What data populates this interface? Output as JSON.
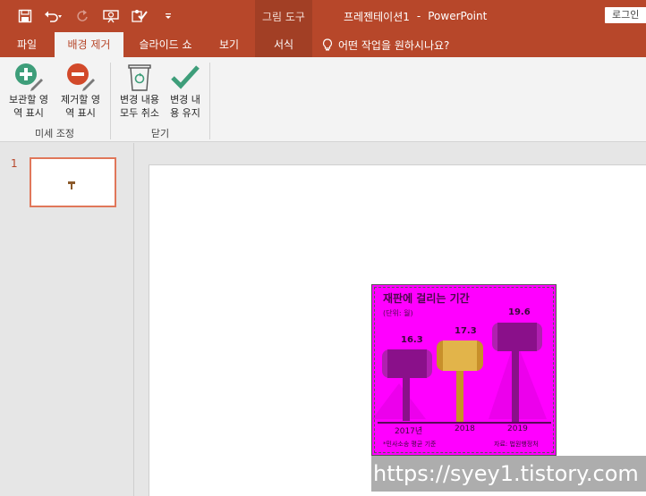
{
  "titlebar": {
    "context_group": "그림 도구",
    "doc_name": "프레젠테이션1",
    "separator": "-",
    "app_name": "PowerPoint",
    "login": "로그인"
  },
  "tabs": [
    {
      "label": "파일"
    },
    {
      "label": "배경 제거"
    },
    {
      "label": "슬라이드 쇼"
    },
    {
      "label": "보기"
    },
    {
      "label": "서식"
    }
  ],
  "tellme": "어떤 작업을 원하시나요?",
  "ribbon": {
    "keep_line1": "보관할 영",
    "keep_line2": "역 표시",
    "remove_line1": "제거할 영",
    "remove_line2": "역 표시",
    "discard_line1": "변경 내용",
    "discard_line2": "모두 취소",
    "keep_changes_line1": "변경 내",
    "keep_changes_line2": "용 유지",
    "group_refine": "미세 조정",
    "group_close": "닫기"
  },
  "thumbnail": {
    "number": "1"
  },
  "picture": {
    "title": "재판에 걸리는 기간",
    "unit": "(단위: 월)",
    "values": [
      "16.3",
      "17.3",
      "19.6"
    ],
    "years": [
      "2017년",
      "2018",
      "2019"
    ],
    "note_left": "*민사소송 평균 기준",
    "note_right": "자료: 법원행정처"
  },
  "watermark": "https://syey1.tistory.com",
  "colors": {
    "accent": "#b7472a",
    "pink": "#ff00ff",
    "ribbon": "#f3f3f3"
  }
}
